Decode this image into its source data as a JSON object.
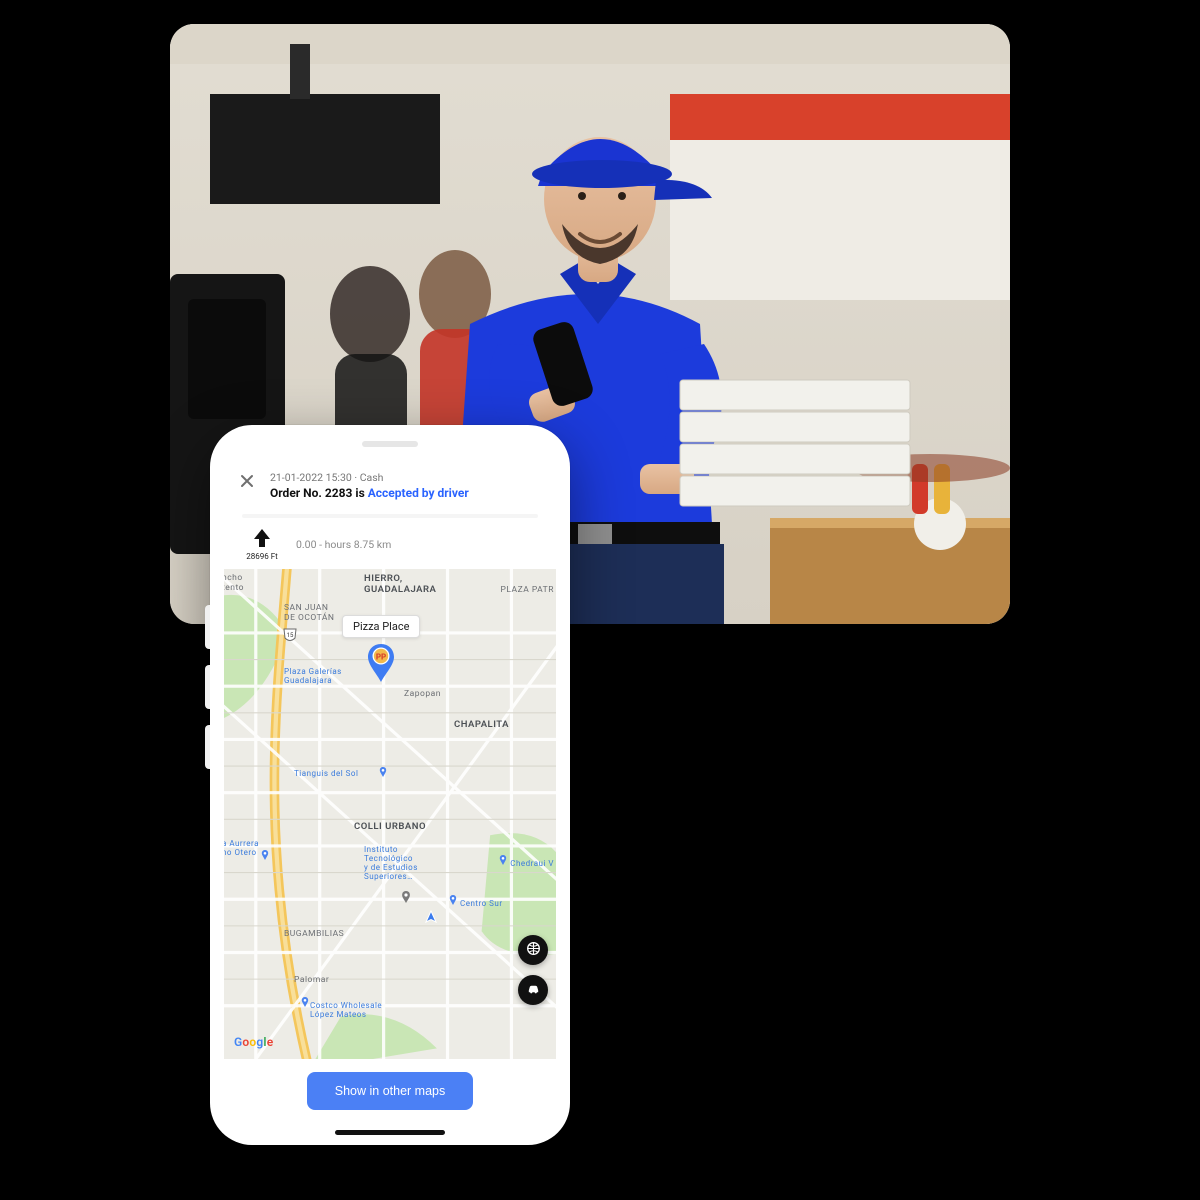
{
  "header": {
    "timestamp": "21-01-2022 15:30",
    "payment": "Cash",
    "order_prefix": "Order No. ",
    "order_number": "2283",
    "order_is": " is ",
    "status": "Accepted by driver"
  },
  "nav": {
    "arrow_distance": "28696 Ft",
    "eta": "0.00 - hours 8.75 km"
  },
  "map": {
    "pin_label": "Pizza Place",
    "pin_badge": "PP",
    "attribution_text": "Google",
    "labels": {
      "hierro": "HIERRO,\nGUADALAJARA",
      "zapopan": "Zapopan",
      "chapalita": "CHAPALITA",
      "colli": "COLLI URBANO",
      "bugambilias": "BUGAMBILIAS",
      "palomar": "Palomar",
      "san_juan": "SAN JUAN\nDE OCOTÁN",
      "plaza_pata": "PLAZA PATR",
      "plaza_galerias": "Plaza Galerías\nGuadalajara",
      "tianguis": "Tianguis del Sol",
      "instituto": "Instituto\nTecnológico\ny de Estudios\nSuperiores…",
      "centro_sur": "Centro Sur",
      "chedraui": "Chedraui V",
      "aurrera": "a Aurrera\nno Otero",
      "costco": "Costco Wholesale\nLópez Mateos",
      "rancho": "ncho\ntento",
      "hwy15": "15"
    }
  },
  "bottom": {
    "primary_label": "Show in other maps"
  },
  "colors": {
    "accent": "#4b80f5",
    "status": "#2a63ff"
  }
}
